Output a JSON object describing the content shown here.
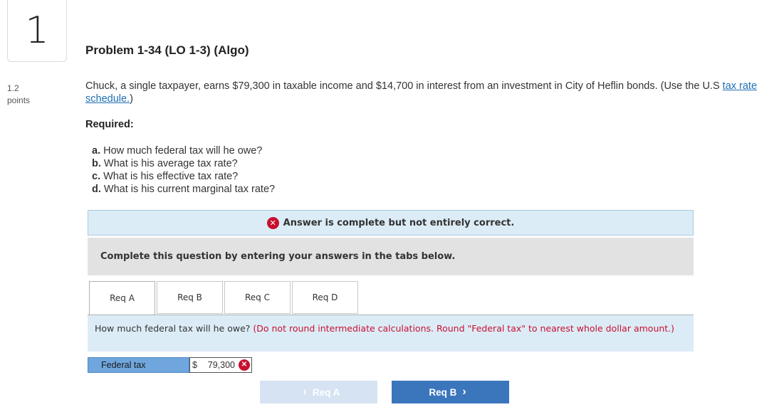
{
  "question": {
    "number": "1",
    "points_value": "1.2",
    "points_label": "points",
    "title": "Problem 1-34 (LO 1-3) (Algo)",
    "prompt_text": "Chuck, a single taxpayer, earns $79,300 in taxable income and $14,700 in interest from an investment in City of Heflin bonds. (Use the U.S ",
    "prompt_link": "tax rate schedule.",
    "prompt_end": ")",
    "required_label": "Required:",
    "parts": [
      {
        "letter": "a.",
        "text": "How much federal tax will he owe?"
      },
      {
        "letter": "b.",
        "text": "What is his average tax rate?"
      },
      {
        "letter": "c.",
        "text": "What is his effective tax rate?"
      },
      {
        "letter": "d.",
        "text": "What is his current marginal tax rate?"
      }
    ]
  },
  "feedback": {
    "status_icon": "x-circle-icon",
    "message": "Answer is complete but not entirely correct.",
    "error_color": "#c8102e"
  },
  "instructions": "Complete this question by entering your answers in the tabs below.",
  "tabs": [
    {
      "label": "Req A",
      "active": true
    },
    {
      "label": "Req B",
      "active": false
    },
    {
      "label": "Req C",
      "active": false
    },
    {
      "label": "Req D",
      "active": false
    }
  ],
  "panel": {
    "question": "How much federal tax will he owe?",
    "hint": "(Do not round intermediate calculations. Round \"Federal tax\" to nearest whole dollar amount.)"
  },
  "answer": {
    "label": "Federal tax",
    "currency": "$",
    "value": "79,300",
    "mark_icon": "x-circle-icon"
  },
  "navigation": {
    "prev_label": "Req A",
    "next_label": "Req B",
    "prev_icon": "chevron-left-icon",
    "next_icon": "chevron-right-icon"
  }
}
